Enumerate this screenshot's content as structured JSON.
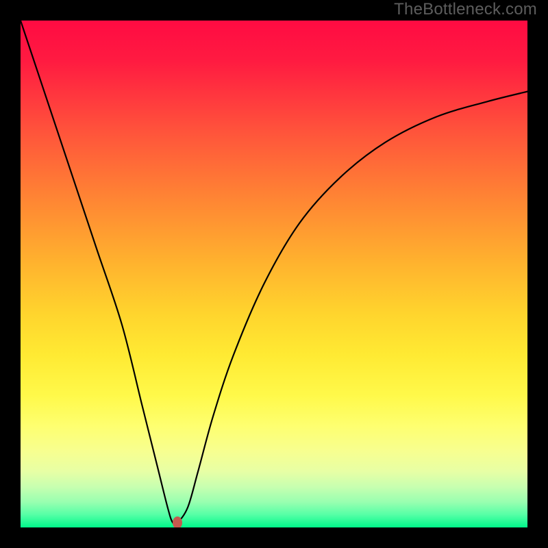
{
  "watermark": "TheBottleneck.com",
  "chart_data": {
    "type": "line",
    "title": "",
    "xlabel": "",
    "ylabel": "",
    "xlim": [
      0,
      100
    ],
    "ylim": [
      0,
      100
    ],
    "grid": false,
    "legend": false,
    "background": "rainbow-gradient",
    "series": [
      {
        "name": "bottleneck-curve",
        "x": [
          0,
          5,
          10,
          15,
          20,
          24,
          27,
          29,
          30,
          31,
          33,
          35,
          38,
          42,
          48,
          55,
          63,
          72,
          82,
          92,
          100
        ],
        "values": [
          100,
          85,
          70,
          55,
          40,
          24,
          12,
          4,
          1,
          1,
          4,
          11,
          22,
          34,
          48,
          60,
          69,
          76,
          81,
          84,
          86
        ]
      }
    ],
    "marker": {
      "x": 31,
      "y": 1,
      "color": "#c45a4f"
    },
    "notes": "V-shaped curve with minimum near x≈30; background is red→green vertical gradient indicating bottleneck severity."
  },
  "colors": {
    "frame": "#000000",
    "curve": "#000000",
    "marker": "#c45a4f",
    "watermark": "#5d5d5d"
  }
}
